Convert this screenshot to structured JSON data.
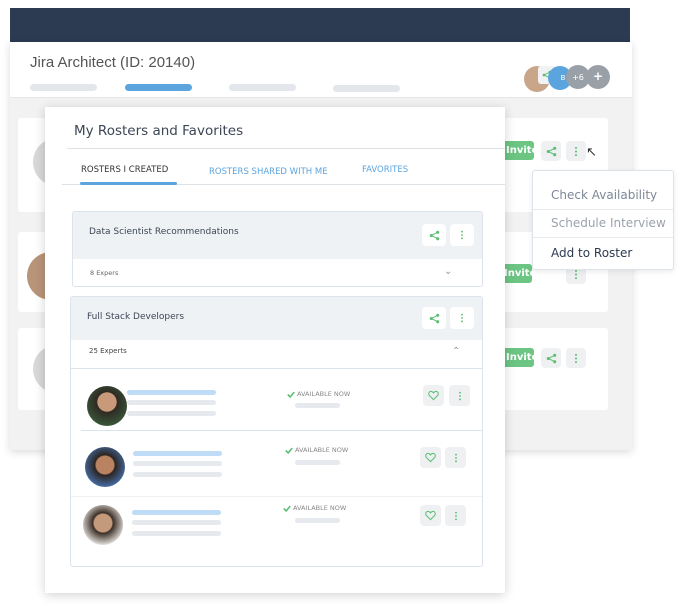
{
  "window": {
    "title": "Jira Architect  (ID: 20140)",
    "avatar_count": "+6",
    "avatar_initial": "B"
  },
  "candidate_rows": [
    {
      "invite": "Invite"
    },
    {
      "invite": "Invite"
    },
    {
      "invite": "Invite"
    }
  ],
  "context_menu": {
    "items": [
      "Check Availability",
      "Schedule Interview",
      "Add to Roster"
    ]
  },
  "modal": {
    "title": "My Rosters and Favorites",
    "tabs": [
      {
        "label": "ROSTERS I CREATED",
        "active": true
      },
      {
        "label": "ROSTERS SHARED WITH ME"
      },
      {
        "label": "FAVORITES"
      }
    ],
    "rosters": [
      {
        "name": "Data Scientist Recommendations",
        "count": "8 Expers",
        "expanded": false
      },
      {
        "name": "Full Stack Developers",
        "count": "25 Experts",
        "expanded": true
      }
    ],
    "experts": [
      {
        "status": "AVAILABLE NOW"
      },
      {
        "status": "AVAILABLE NOW"
      },
      {
        "status": "AVAILABLE NOW"
      }
    ]
  },
  "colors": {
    "accent": "#5ba4de",
    "green": "#6cc583",
    "header": "#2c3a52"
  }
}
